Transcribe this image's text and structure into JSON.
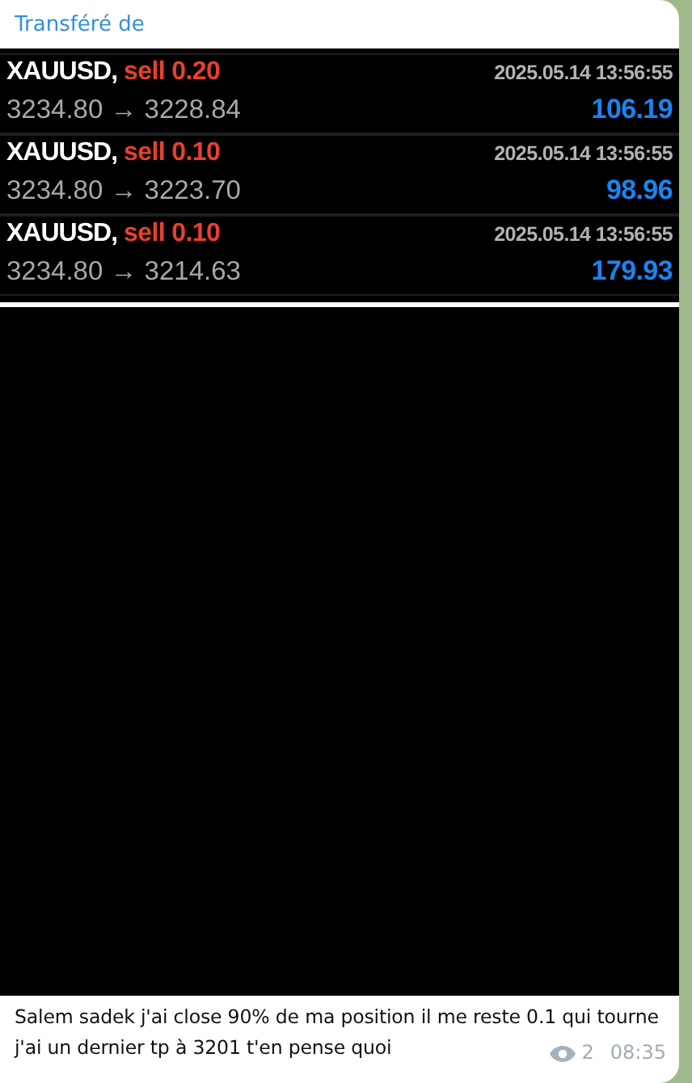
{
  "forwarded": {
    "label": "Transféré de"
  },
  "trades": [
    {
      "symbol": "XAUUSD,",
      "order": "sell 0.20",
      "time": "2025.05.14 13:56:55",
      "prices": "3234.80 → 3228.84",
      "profit": "106.19"
    },
    {
      "symbol": "XAUUSD,",
      "order": "sell 0.10",
      "time": "2025.05.14 13:56:55",
      "prices": "3234.80 → 3223.70",
      "profit": "98.96"
    },
    {
      "symbol": "XAUUSD,",
      "order": "sell 0.10",
      "time": "2025.05.14 13:56:55",
      "prices": "3234.80 → 3214.63",
      "profit": "179.93"
    }
  ],
  "caption_lines": [
    "Salem sadek j'ai close 90% de ma position il me reste 0.1 qui tourne",
    "j'ai un dernier tp à 3201 t'en pense quoi"
  ],
  "views": "2",
  "time": "08:35"
}
